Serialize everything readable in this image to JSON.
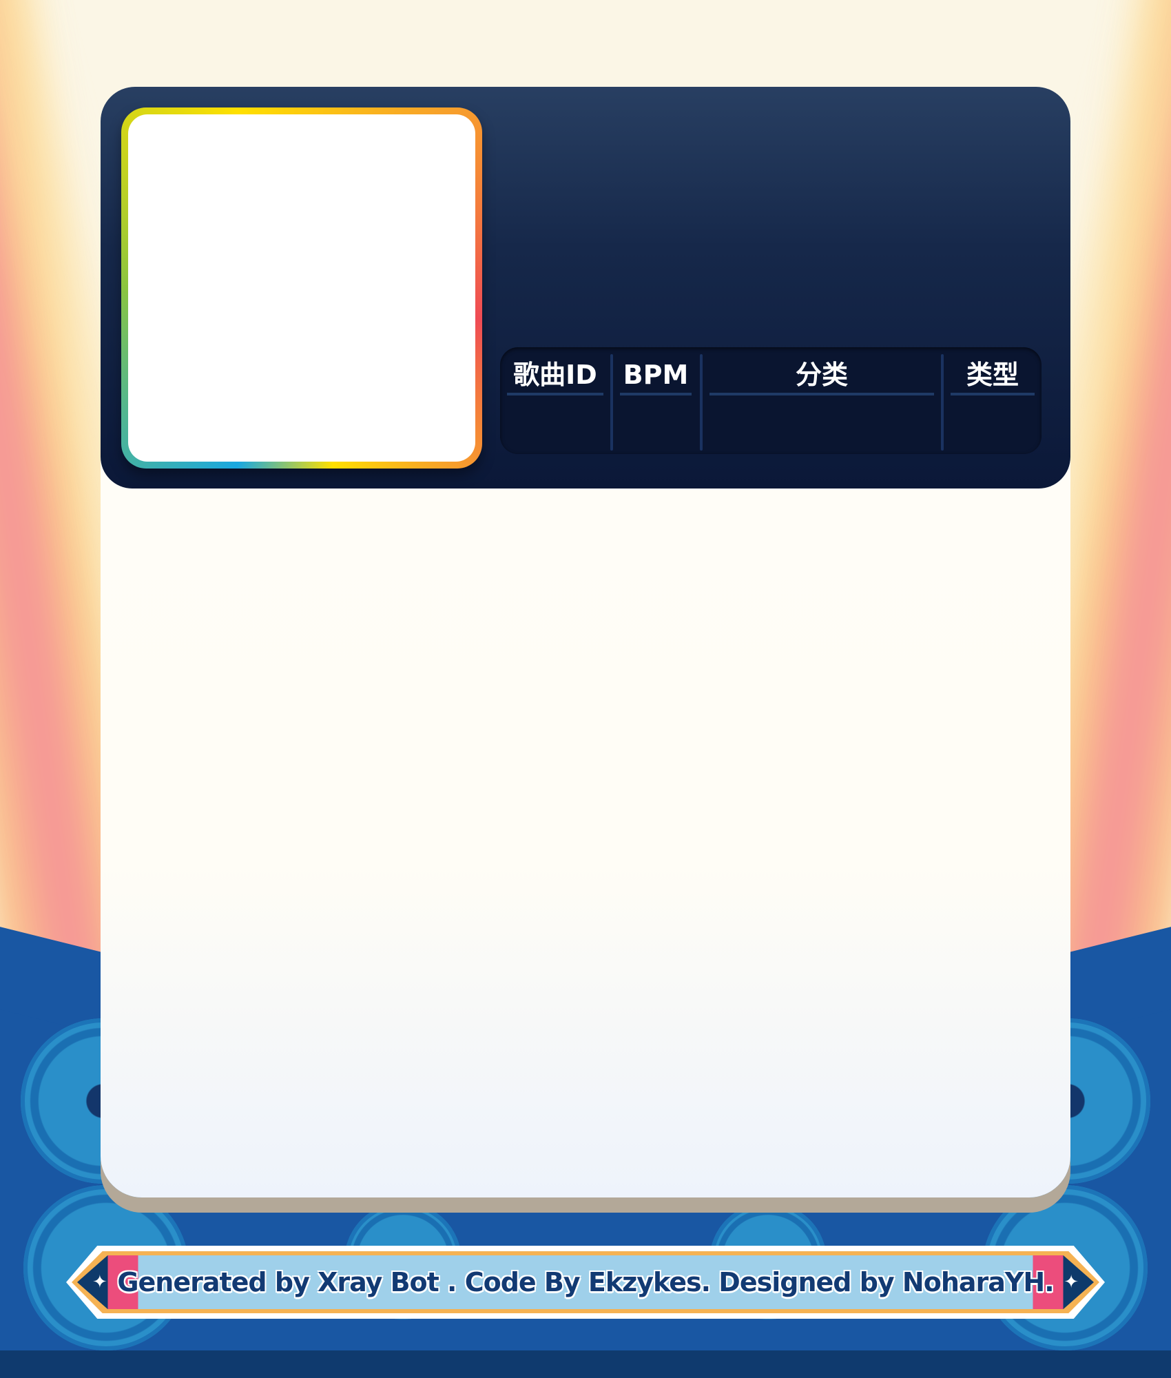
{
  "song_info": {
    "headers": {
      "song_id": "歌曲ID",
      "bpm": "BPM",
      "category": "分类",
      "type": "类型"
    },
    "values": {
      "song_id": "",
      "bpm": "",
      "category": "",
      "type": ""
    }
  },
  "footer": {
    "text": "Generated by Xray Bot . Code By Ekzykes. Designed by NoharaYH."
  },
  "icons": {
    "footer_left": "star-icon",
    "footer_right": "star-icon"
  },
  "colors": {
    "header_bg": "#16284a",
    "table_bg": "#0a1530",
    "accent_blue": "#1aa7e0",
    "accent_green": "#8bc53f",
    "accent_yellow": "#ffe000",
    "accent_orange": "#f7a02b",
    "accent_red": "#ef4b55",
    "footer_text": "#123a73"
  }
}
